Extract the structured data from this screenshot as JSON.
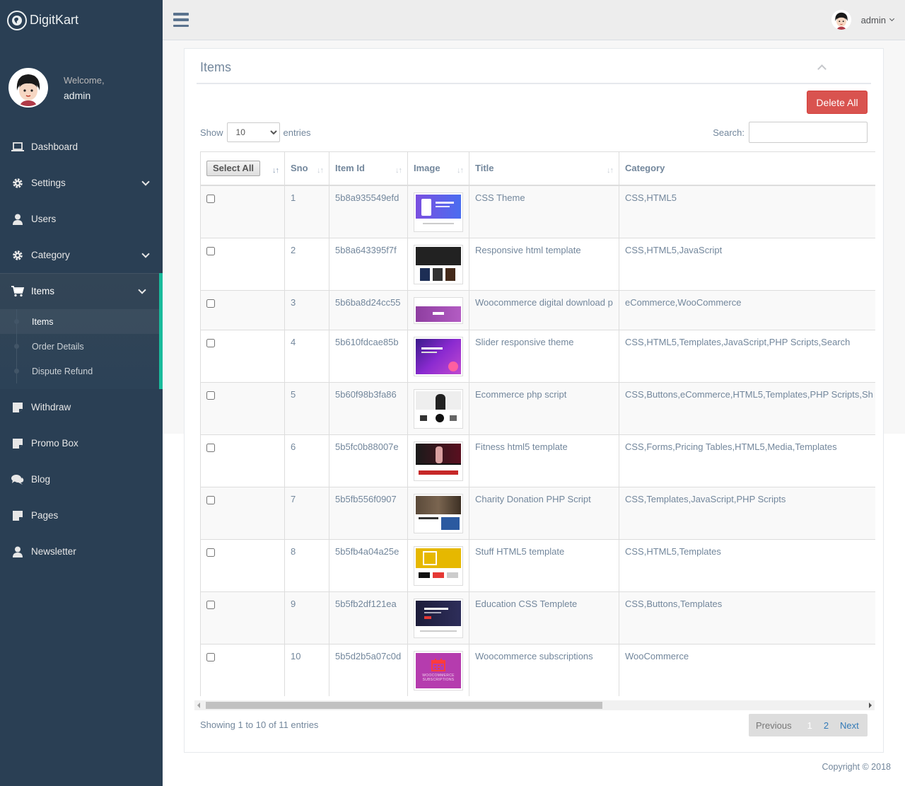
{
  "brand": {
    "name": "DigitKart",
    "logo_icon": "globe-icon"
  },
  "profile": {
    "welcome": "Welcome,",
    "name": "admin"
  },
  "menu": {
    "dashboard": "Dashboard",
    "settings": "Settings",
    "users": "Users",
    "category": "Category",
    "items": "Items",
    "items_sub": [
      "Items",
      "Order Details",
      "Dispute Refund"
    ],
    "withdraw": "Withdraw",
    "promo_box": "Promo Box",
    "blog": "Blog",
    "pages": "Pages",
    "newsletter": "Newsletter"
  },
  "topnav": {
    "user": "admin"
  },
  "panel": {
    "title": "Items",
    "delete_all": "Delete All"
  },
  "table_controls": {
    "show": "Show",
    "entries": "entries",
    "page_length": "10",
    "search_label": "Search:"
  },
  "columns": {
    "select_all": "Select All",
    "sno": "Sno",
    "item_id": "Item Id",
    "image": "Image",
    "title": "Title",
    "category": "Category"
  },
  "rows": [
    {
      "sno": "1",
      "item_id": "5b8a935549efd",
      "title": "CSS Theme",
      "category": "CSS,HTML5"
    },
    {
      "sno": "2",
      "item_id": "5b8a643395f7f",
      "title": "Responsive html template",
      "category": "CSS,HTML5,JavaScript"
    },
    {
      "sno": "3",
      "item_id": "5b6ba8d24cc55",
      "title": "Woocommerce digital download p",
      "category": "eCommerce,WooCommerce"
    },
    {
      "sno": "4",
      "item_id": "5b610fdcae85b",
      "title": "Slider responsive theme",
      "category": "CSS,HTML5,Templates,JavaScript,PHP Scripts,Search"
    },
    {
      "sno": "5",
      "item_id": "5b60f98b3fa86",
      "title": "Ecommerce php script",
      "category": "CSS,Buttons,eCommerce,HTML5,Templates,PHP Scripts,Sh"
    },
    {
      "sno": "6",
      "item_id": "5b5fc0b88007e",
      "title": "Fitness html5 template",
      "category": "CSS,Forms,Pricing Tables,HTML5,Media,Templates"
    },
    {
      "sno": "7",
      "item_id": "5b5fb556f0907",
      "title": "Charity Donation PHP Script",
      "category": "CSS,Templates,JavaScript,PHP Scripts"
    },
    {
      "sno": "8",
      "item_id": "5b5fb4a04a25e",
      "title": "Stuff HTML5 template",
      "category": "CSS,HTML5,Templates"
    },
    {
      "sno": "9",
      "item_id": "5b5fb2df121ea",
      "title": "Education CSS Templete",
      "category": "CSS,Buttons,Templates"
    },
    {
      "sno": "10",
      "item_id": "5b5d2b5a07c0d",
      "title": "Woocommerce subscriptions",
      "category": "WooCommerce"
    }
  ],
  "thumb_caption": "WOOCOMMERCE SUBSCRIPTIONS",
  "footer_table": {
    "info": "Showing 1 to 10 of 11 entries",
    "previous": "Previous",
    "page1": "1",
    "page2": "2",
    "next": "Next"
  },
  "scroll": {
    "horizontal_position": 0,
    "visible_fraction": 0.59
  },
  "copyright": "Copyright © 2018",
  "colors": {
    "sidebar": "#2a3f54",
    "accent": "#1ABB9C",
    "danger": "#d9534f",
    "link": "#337ab7",
    "text": "#73879c"
  }
}
